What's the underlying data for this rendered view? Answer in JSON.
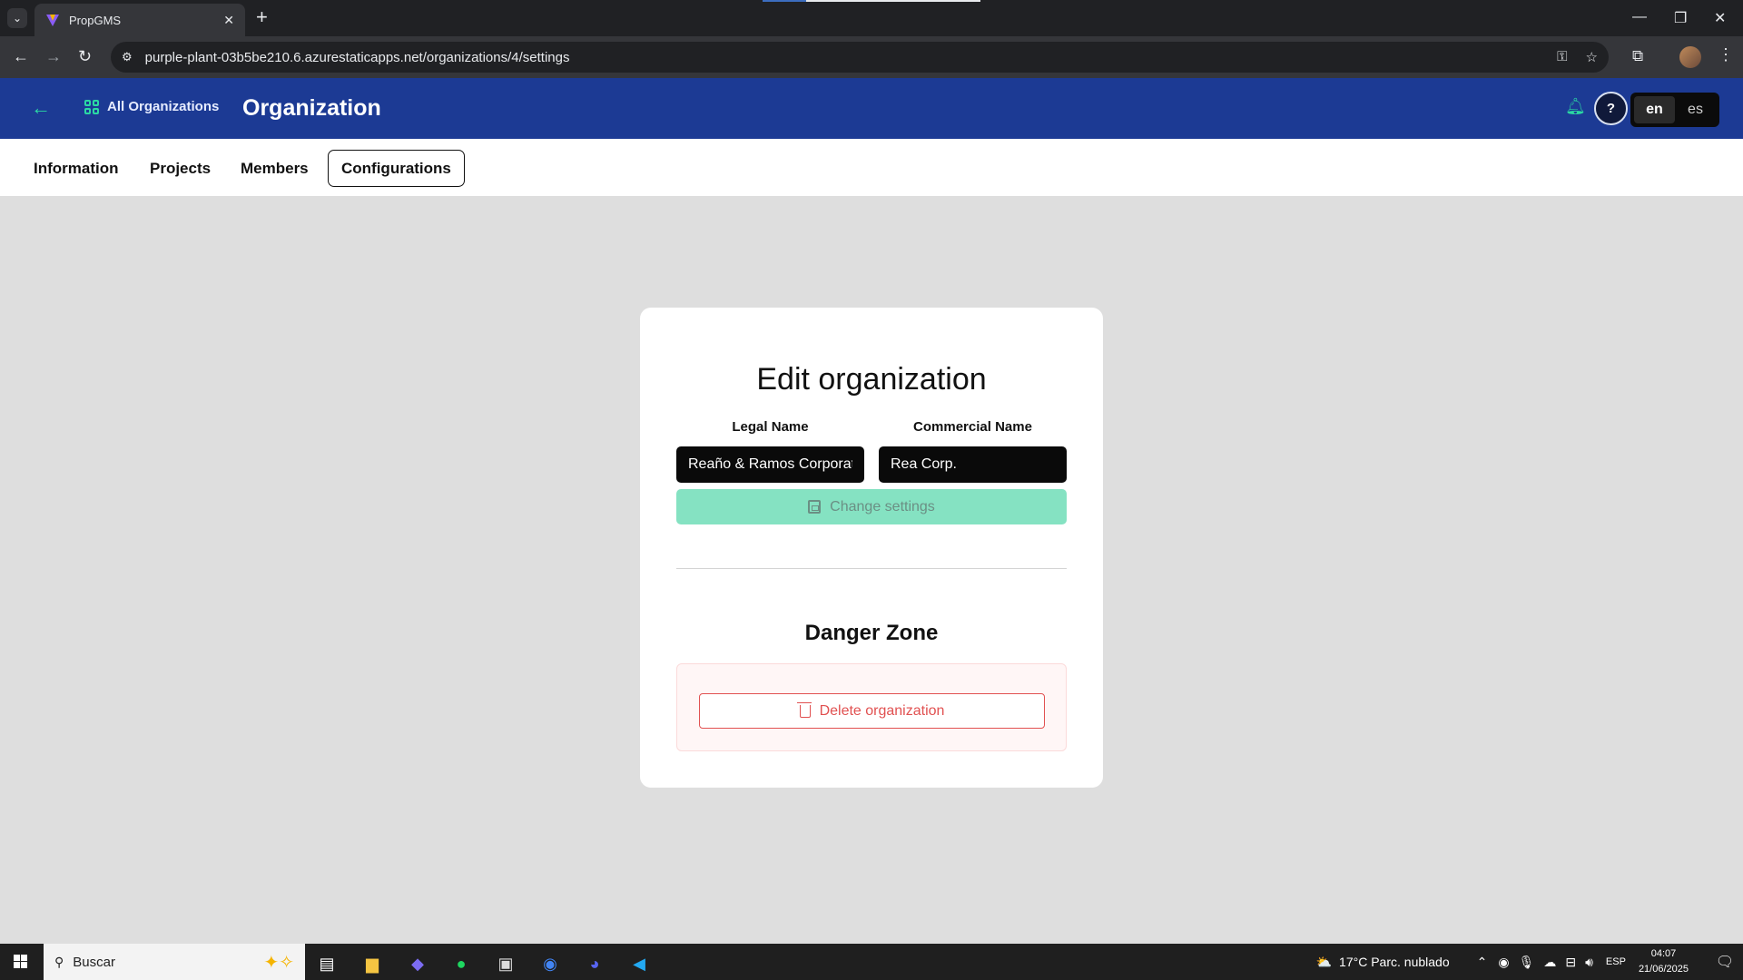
{
  "browser": {
    "tab_title": "PropGMS",
    "url": "purple-plant-03b5be210.6.azurestaticapps.net/organizations/4/settings"
  },
  "header": {
    "all_orgs_label": "All Organizations",
    "title": "Organization",
    "help_label": "?",
    "languages": [
      "en",
      "es"
    ],
    "active_language": "en",
    "accent_color": "#2bd9a3",
    "bg_color": "#1c3a94"
  },
  "nav_tabs": [
    {
      "label": "Information"
    },
    {
      "label": "Projects"
    },
    {
      "label": "Members"
    },
    {
      "label": "Configurations",
      "selected": true
    }
  ],
  "form": {
    "title": "Edit organization",
    "legal_name_label": "Legal Name",
    "legal_name_value": "Reaño & Ramos Corporation",
    "commercial_name_label": "Commercial Name",
    "commercial_name_value": "Rea Corp.",
    "change_button": "Change settings"
  },
  "danger": {
    "title": "Danger Zone",
    "delete_button": "Delete organization",
    "color": "#e15151"
  },
  "taskbar": {
    "search_placeholder": "Buscar",
    "weather": "17°C  Parc. nublado",
    "language": "ESP",
    "time": "04:07",
    "date": "21/06/2025"
  }
}
